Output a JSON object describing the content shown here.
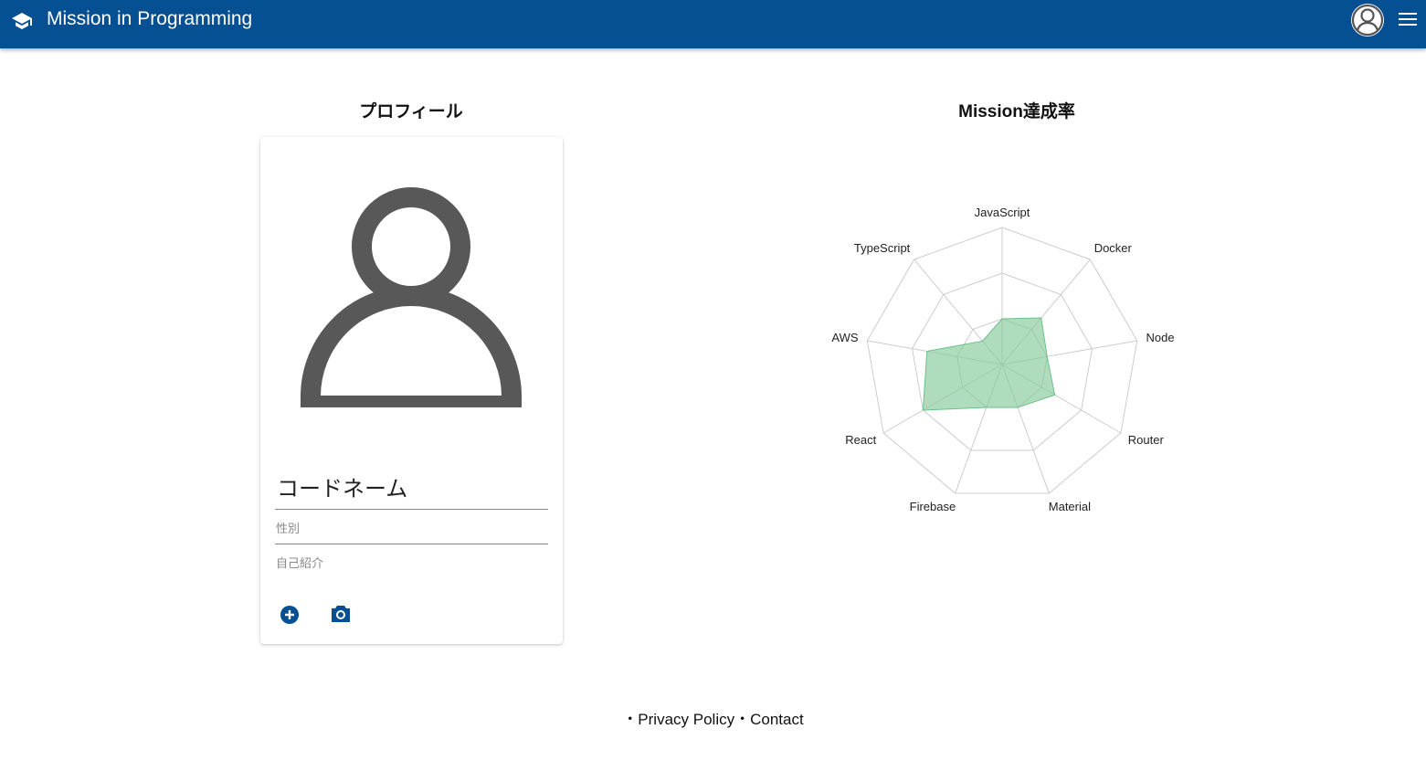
{
  "header": {
    "title": "Mission in Programming",
    "logo_icon": "graduation-cap-icon",
    "account_icon": "account-circle-icon",
    "menu_icon": "menu-icon",
    "color": "#054f93"
  },
  "profile": {
    "heading": "プロフィール",
    "codename_label": "コードネーム",
    "gender_label": "性別",
    "intro_label": "自己紹介",
    "add_icon": "add-circle-icon",
    "camera_icon": "camera-icon"
  },
  "mission": {
    "heading": "Mission達成率"
  },
  "chart_data": {
    "type": "radar",
    "categories": [
      "JavaScript",
      "Docker",
      "Node",
      "Router",
      "Material",
      "Firebase",
      "React",
      "AWS",
      "TypeScript"
    ],
    "values": [
      1,
      1.33,
      1,
      1.33,
      1,
      1,
      2,
      1.67,
      0.67
    ],
    "range": [
      0,
      3
    ],
    "grid_levels": 3,
    "fill_color": "#82c99a"
  },
  "footer": {
    "privacy": "・Privacy Policy",
    "contact": "・Contact"
  }
}
